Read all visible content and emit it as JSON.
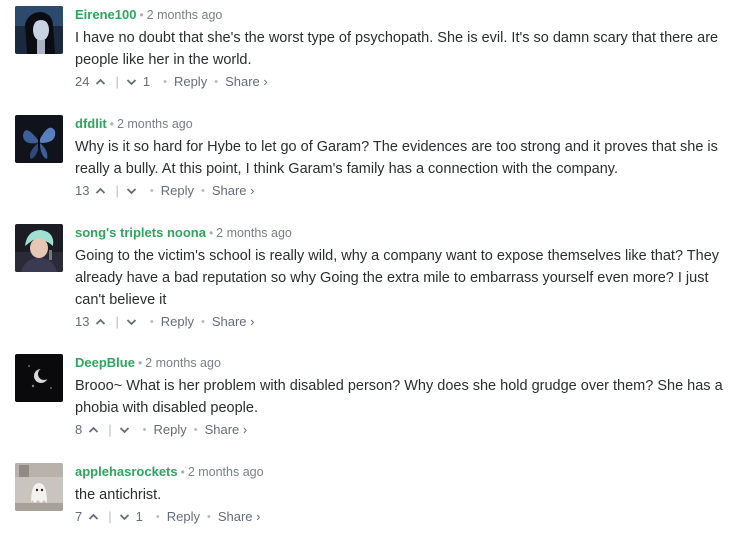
{
  "comments": [
    {
      "username": "Eirene100",
      "time": "2 months ago",
      "text": "I have no doubt that she's the worst type of psychopath. She is evil. It's so damn scary that there are people like her in the world.",
      "upvotes": "24",
      "downvotes": "1",
      "reply_label": "Reply",
      "share_label": "Share ›",
      "avatar": "avatar-dark-hair-woman"
    },
    {
      "username": "dfdlit",
      "time": "2 months ago",
      "text": "Why is it so hard for Hybe to let go of Garam? The evidences are too strong and it proves that she is really a bully. At this point, I think Garam's family has a connection with the company.",
      "upvotes": "13",
      "downvotes": "",
      "reply_label": "Reply",
      "share_label": "Share ›",
      "avatar": "avatar-blue-butterfly"
    },
    {
      "username": "song's triplets noona",
      "time": "2 months ago",
      "text": "Going to the victim's school is really wild, why a company want to expose themselves like that? They already have a bad reputation so why Going the extra mile to embarrass yourself even more? I just can't believe it",
      "upvotes": "13",
      "downvotes": "",
      "reply_label": "Reply",
      "share_label": "Share ›",
      "avatar": "avatar-mint-hair-singer"
    },
    {
      "username": "DeepBlue",
      "time": "2 months ago",
      "text": "Brooo~ What is her problem with disabled person? Why does she hold grudge over them? She has a phobia with disabled people.",
      "upvotes": "8",
      "downvotes": "",
      "reply_label": "Reply",
      "share_label": "Share ›",
      "avatar": "avatar-moon-night"
    },
    {
      "username": "applehasrockets",
      "time": "2 months ago",
      "text": "the antichrist.",
      "upvotes": "7",
      "downvotes": "1",
      "reply_label": "Reply",
      "share_label": "Share ›",
      "avatar": "avatar-ghost-room"
    }
  ],
  "colors": {
    "username": "#2ea55e",
    "text": "#2a2e2e",
    "muted": "#656c7a"
  }
}
